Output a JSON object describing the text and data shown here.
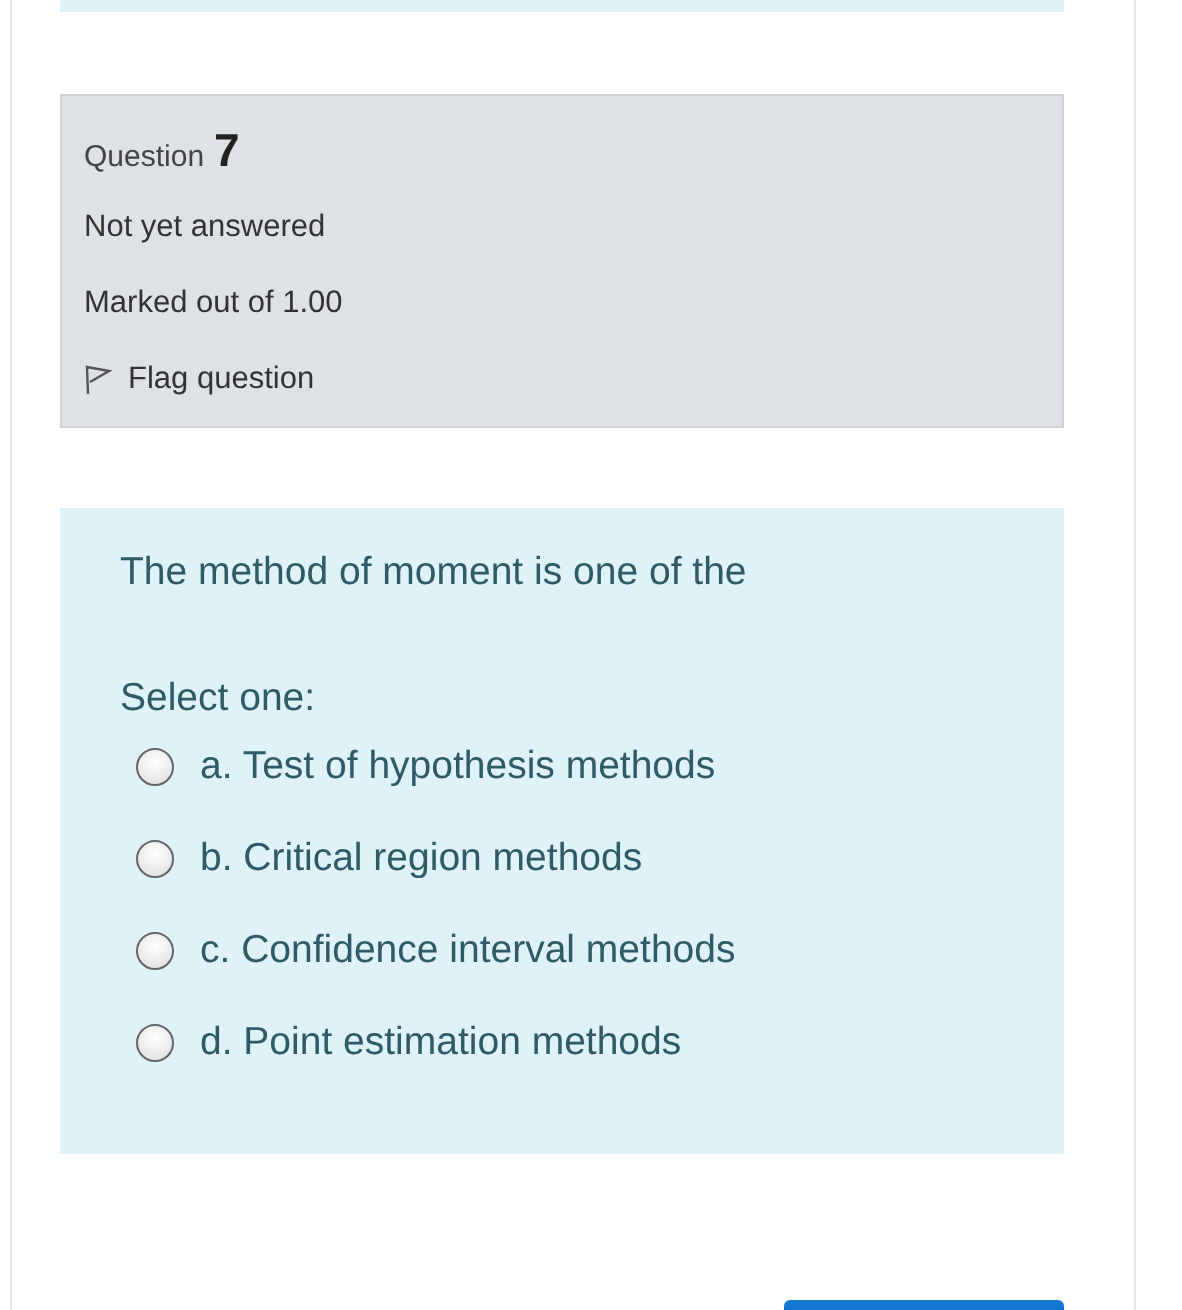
{
  "question_info": {
    "label": "Question",
    "number": "7",
    "state": "Not yet answered",
    "marks": "Marked out of 1.00",
    "flag": {
      "label": "Flag question",
      "flagged": false
    }
  },
  "question": {
    "text": "The method of moment is one of the",
    "prompt": "Select one:",
    "options": [
      {
        "label": "a. Test of hypothesis methods",
        "selected": false
      },
      {
        "label": "b. Critical region methods",
        "selected": false
      },
      {
        "label": "c. Confidence interval methods",
        "selected": false
      },
      {
        "label": "d. Point estimation methods",
        "selected": false
      }
    ]
  }
}
